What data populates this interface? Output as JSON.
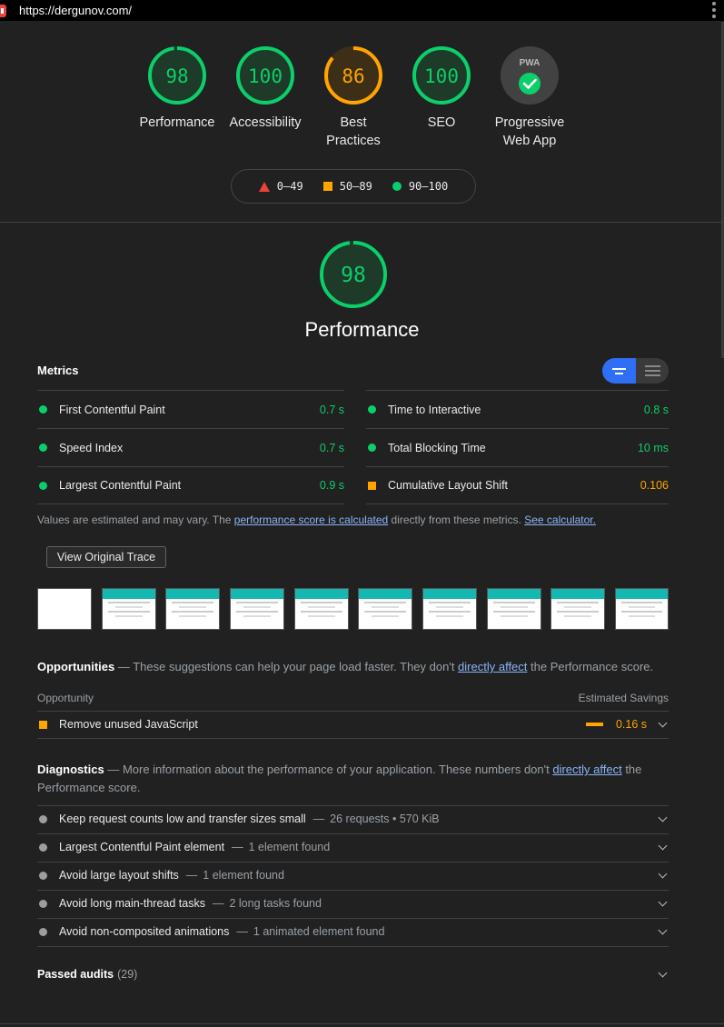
{
  "browser": {
    "url": "https://dergunov.com/"
  },
  "gauges": [
    {
      "score": "98",
      "label": "Performance",
      "color": "#0cce6b",
      "fraction": 0.98
    },
    {
      "score": "100",
      "label": "Accessibility",
      "color": "#0cce6b",
      "fraction": 1.0
    },
    {
      "score": "86",
      "label_lines": [
        "Best",
        "Practices"
      ],
      "color": "#ffa400",
      "fraction": 0.86
    },
    {
      "score": "100",
      "label": "SEO",
      "color": "#0cce6b",
      "fraction": 1.0
    },
    {
      "badge": "PWA",
      "label_lines": [
        "Progressive",
        "Web App"
      ]
    }
  ],
  "legend": {
    "fail": "0–49",
    "average": "50–89",
    "pass": "90–100"
  },
  "performance": {
    "score": "98",
    "fraction": 0.98,
    "title": "Performance",
    "metrics_label": "Metrics",
    "metrics": [
      {
        "name": "First Contentful Paint",
        "value": "0.7 s",
        "status": "pass"
      },
      {
        "name": "Time to Interactive",
        "value": "0.8 s",
        "status": "pass"
      },
      {
        "name": "Speed Index",
        "value": "0.7 s",
        "status": "pass"
      },
      {
        "name": "Total Blocking Time",
        "value": "10 ms",
        "status": "pass"
      },
      {
        "name": "Largest Contentful Paint",
        "value": "0.9 s",
        "status": "pass"
      },
      {
        "name": "Cumulative Layout Shift",
        "value": "0.106",
        "status": "average"
      }
    ],
    "note_prefix": "Values are estimated and may vary. The ",
    "note_link1": "performance score is calculated",
    "note_middle": " directly from these metrics. ",
    "note_link2": "See calculator.",
    "trace_button": "View Original Trace"
  },
  "opportunities": {
    "title": "Opportunities",
    "desc_prefix": "These suggestions can help your page load faster. They don't ",
    "desc_link": "directly affect",
    "desc_suffix": " the Performance score.",
    "col_opportunity": "Opportunity",
    "col_savings": "Estimated Savings",
    "items": [
      {
        "name": "Remove unused JavaScript",
        "savings": "0.16 s"
      }
    ]
  },
  "diagnostics": {
    "title": "Diagnostics",
    "desc_prefix": "More information about the performance of your application. These numbers don't ",
    "desc_link": "directly affect",
    "desc_suffix_1": " the",
    "desc_suffix_2": "Performance score.",
    "items": [
      {
        "name": "Keep request counts low and transfer sizes small",
        "detail": "26 requests • 570 KiB"
      },
      {
        "name": "Largest Contentful Paint element",
        "detail": "1 element found"
      },
      {
        "name": "Avoid large layout shifts",
        "detail": "1 element found"
      },
      {
        "name": "Avoid long main-thread tasks",
        "detail": "2 long tasks found"
      },
      {
        "name": "Avoid non-composited animations",
        "detail": "1 animated element found"
      }
    ]
  },
  "passed": {
    "label": "Passed audits",
    "count": "(29)"
  },
  "separator": "—"
}
